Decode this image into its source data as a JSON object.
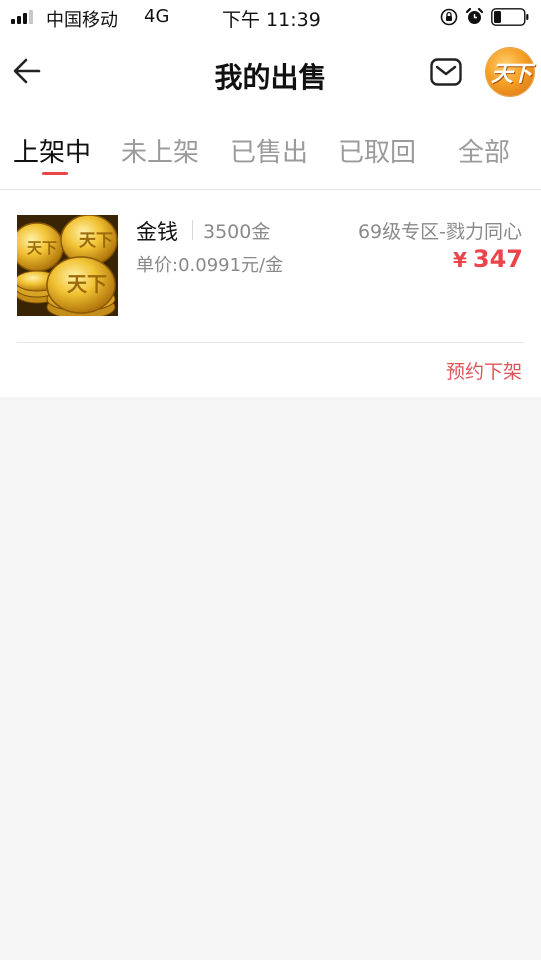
{
  "status_bar": {
    "carrier": "中国移动",
    "network": "4G",
    "time": "下午 11:39"
  },
  "header": {
    "title": "我的出售",
    "back_icon": "arrow-left-icon",
    "mail_icon": "mail-icon",
    "avatar_text": "天下"
  },
  "tabs": [
    {
      "label": "上架中",
      "active": true
    },
    {
      "label": "未上架",
      "active": false
    },
    {
      "label": "已售出",
      "active": false
    },
    {
      "label": "已取回",
      "active": false
    },
    {
      "label": "全部",
      "active": false
    }
  ],
  "order": {
    "image_text": "天下",
    "name": "金钱",
    "quantity": "3500金",
    "server": "69级专区-戮力同心",
    "unit_price": "单价:0.0991元/金",
    "currency": "¥",
    "price": "347",
    "action": "预约下架"
  },
  "colors": {
    "accent": "#e9454a",
    "gold": "#f0b42a"
  }
}
